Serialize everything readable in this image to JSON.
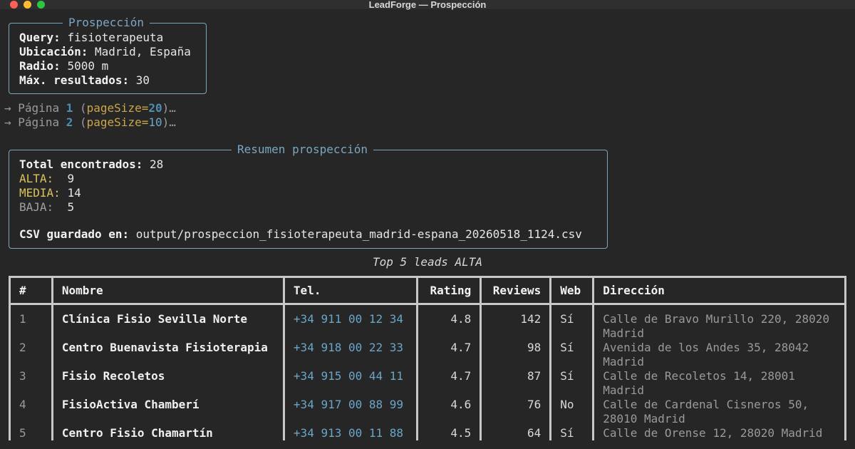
{
  "window": {
    "title": "LeadForge — Prospección"
  },
  "query_panel": {
    "title": "Prospección",
    "rows": [
      {
        "label": "Query:",
        "value": "fisioterapeuta"
      },
      {
        "label": "Ubicación:",
        "value": "Madrid, España"
      },
      {
        "label": "Radio:",
        "value": "5000 m"
      },
      {
        "label": "Máx. resultados:",
        "value": "30"
      }
    ]
  },
  "progress": [
    {
      "arrow": "→",
      "prefix": "Página",
      "page": "1",
      "paren_open": "(",
      "key": "pageSize=",
      "size": "20",
      "suffix": ")…"
    },
    {
      "arrow": "→",
      "prefix": "Página",
      "page": "2",
      "paren_open": "(",
      "key": "pageSize=",
      "size": "10",
      "suffix": ")…"
    }
  ],
  "summary_panel": {
    "title": "Resumen prospección",
    "total_label": "Total encontrados:",
    "total_value": "28",
    "alta_label": "ALTA:",
    "alta_value": "9",
    "media_label": "MEDIA:",
    "media_value": "14",
    "baja_label": "BAJA:",
    "baja_value": "5",
    "csv_label": "CSV guardado en:",
    "csv_path": "output/prospeccion_fisioterapeuta_madrid-espana_20260518_1124.csv"
  },
  "table": {
    "caption": "Top 5 leads ALTA",
    "headers": [
      "#",
      "Nombre",
      "Tel.",
      "Rating",
      "Reviews",
      "Web",
      "Dirección"
    ],
    "rows": [
      [
        "1",
        "Clínica Fisio Sevilla Norte",
        "+34 911 00 12 34",
        "4.8",
        "142",
        "Sí",
        "Calle de Bravo Murillo 220, 28020 Madrid"
      ],
      [
        "2",
        "Centro Buenavista Fisioterapia",
        "+34 918 00 22 33",
        "4.7",
        "98",
        "Sí",
        "Avenida de los Andes 35, 28042 Madrid"
      ],
      [
        "3",
        "Fisio Recoletos",
        "+34 915 00 44 11",
        "4.7",
        "87",
        "Sí",
        "Calle de Recoletos 14, 28001 Madrid"
      ],
      [
        "4",
        "FisioActiva Chamberí",
        "+34 917 00 88 99",
        "4.6",
        "76",
        "No",
        "Calle de Cardenal Cisneros 50, 28010 Madrid"
      ],
      [
        "5",
        "Centro Fisio Chamartín",
        "+34 913 00 11 88",
        "4.5",
        "64",
        "Sí",
        "Calle de Orense 12, 28020 Madrid"
      ]
    ]
  },
  "colors": {
    "background": "#262626",
    "panel_border": "#7aa6c2",
    "alta": "#d9c35a",
    "phone": "#6aa6c8"
  }
}
